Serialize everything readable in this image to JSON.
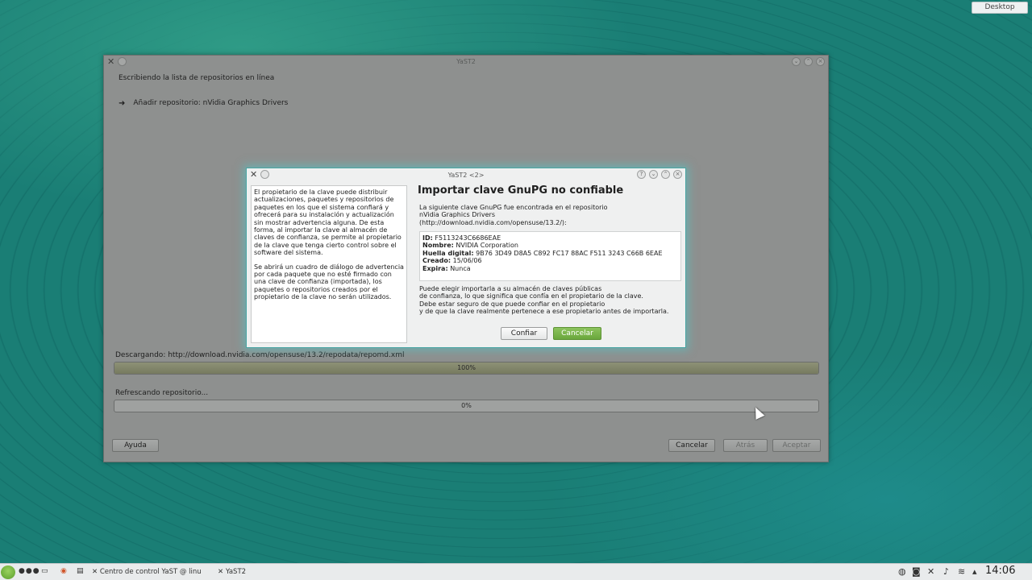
{
  "desktop": {
    "tag": "Desktop"
  },
  "main_window": {
    "title": "YaST2",
    "step_heading": "Escribiendo la lista de repositorios en línea",
    "step_arrow": "➜",
    "step_item": "Añadir repositorio: nVidia Graphics Drivers",
    "download_label": "Descargando: http://download.nvidia.com/opensuse/13.2/repodata/repomd.xml",
    "download_progress": {
      "percent": 100,
      "text": "100%"
    },
    "refresh_label": "Refrescando repositorio...",
    "refresh_progress": {
      "percent": 0,
      "text": "0%"
    },
    "buttons": {
      "help": "Ayuda",
      "cancel": "Cancelar",
      "back": "Atrás",
      "accept": "Aceptar"
    }
  },
  "dialog": {
    "title": "YaST2 <2>",
    "help_paragraph_1": "El propietario de la clave puede distribuir actualizaciones, paquetes y repositorios de paquetes en los que el sistema confiará y ofrecerá para su instalación y actualización sin mostrar advertencia alguna. De esta forma, al importar la clave al almacén de claves de confianza, se permite al propietario de la clave que tenga cierto control sobre el software del sistema.",
    "help_paragraph_2": "Se abrirá un cuadro de diálogo de advertencia por cada paquete que no esté firmado con una clave de confianza (importada), los paquetes o repositorios creados por el propietario de la clave no serán utilizados.",
    "heading": "Importar clave GnuPG no confiable",
    "intro_line_1": "La siguiente clave GnuPG fue encontrada en el repositorio",
    "intro_line_2": "nVidia Graphics Drivers",
    "intro_line_3": "(http://download.nvidia.com/opensuse/13.2/):",
    "key": {
      "id_label": "ID:",
      "id": "F5113243C6686EAE",
      "name_label": "Nombre:",
      "name": "NVIDIA Corporation",
      "fingerprint_label": "Huella digital:",
      "fingerprint": "9B76 3D49 D8A5 C892 FC17 88AC F511 3243 C66B 6EAE",
      "created_label": "Creado:",
      "created": "15/06/06",
      "expires_label": "Expira:",
      "expires": "Nunca"
    },
    "note_line_1": "Puede elegir importarla a su almacén de claves públicas",
    "note_line_2": "de confianza, lo que significa que confía en el propietario de la clave.",
    "note_line_3": "Debe estar seguro de que puede confiar en el propietario",
    "note_line_4": "y de que la clave realmente pertenece a ese propietario antes de importarla.",
    "buttons": {
      "trust": "Confiar",
      "cancel": "Cancelar"
    },
    "accent_color": "#6aa73c"
  },
  "taskbar": {
    "tasks": [
      {
        "label": "Centro de control YaST @ linu"
      },
      {
        "label": "YaST2"
      }
    ],
    "clock": "14:06"
  }
}
